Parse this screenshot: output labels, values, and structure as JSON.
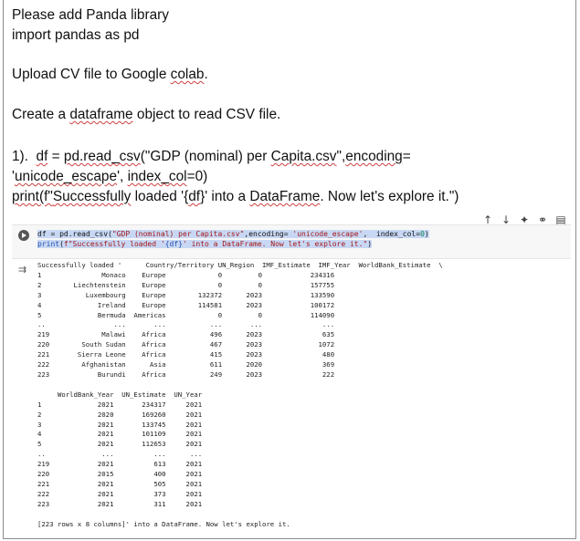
{
  "document": {
    "line1": "Please add Panda library",
    "line2": "import pandas as pd",
    "upload_pre": "Upload CV file to Google ",
    "upload_link": "colab",
    "upload_post": ".",
    "create_pre": "Create a ",
    "create_link": "dataframe",
    "create_post": " object to read CSV file.",
    "step1_a": "1).  ",
    "step1_b": "df",
    "step1_c": " = ",
    "step1_d": "pd.read_csv",
    "step1_e": "(\"GDP (nominal) per ",
    "step1_f": "Capita.csv",
    "step1_g": "\",",
    "step1_h": "encoding",
    "step1_i": "=",
    "step2_a": "'",
    "step2_b": "unicode_escape",
    "step2_c": "', ",
    "step2_d": "index_col",
    "step2_e": "=0)",
    "step3_a": "print(f\"",
    "step3_b": "Successfully",
    "step3_c": " loaded '{",
    "step3_d": "df",
    "step3_e": "}' into a ",
    "step3_f": "DataFrame",
    "step3_g": ". Now let's explore it.\")"
  },
  "toolbar": {
    "icons": [
      "↑",
      "↓",
      "✦",
      "⚭",
      "▤"
    ]
  },
  "code": {
    "l1_a": "df = pd.read_csv(",
    "l1_b": "\"GDP (nominal) per Capita.csv\"",
    "l1_c": ",encoding= ",
    "l1_d": "'unicode_escape'",
    "l1_e": ",  index_col=",
    "l1_f": "0",
    "l1_g": ")",
    "l2_a": "print",
    "l2_b": "(",
    "l2_c": "f\"Successfully loaded '",
    "l2_d": "{df}",
    "l2_e": "' into a DataFrame. Now let's explore it.\"",
    "l2_f": ")"
  },
  "output": {
    "text": "Successfully loaded '      Country/Territory UN_Region  IMF_Estimate  IMF_Year  WorldBank_Estimate  \\\n1               Monaco    Europe             0         0            234316\n2        Liechtenstein    Europe             0         0            157755\n3           Luxembourg    Europe        132372      2023            133590\n4              Ireland    Europe        114581      2023            100172\n5              Bermuda  Americas             0         0            114090\n..                 ...       ...           ...       ...               ...\n219             Malawi    Africa           496      2023               635\n220        South Sudan    Africa           467      2023              1072\n221       Sierra Leone    Africa           415      2023               480\n222        Afghanistan      Asia           611      2020               369\n223            Burundi    Africa           249      2023               222\n\n     WorldBank_Year  UN_Estimate  UN_Year\n1              2021       234317     2021\n2              2020       169260     2021\n3              2021       133745     2021\n4              2021       101109     2021\n5              2021       112653     2021\n..              ...          ...      ...\n219            2021          613     2021\n220            2015          400     2021\n221            2021          505     2021\n222            2021          373     2021\n223            2021          311     2021\n\n[223 rows x 8 columns]' into a DataFrame. Now let's explore it."
  }
}
